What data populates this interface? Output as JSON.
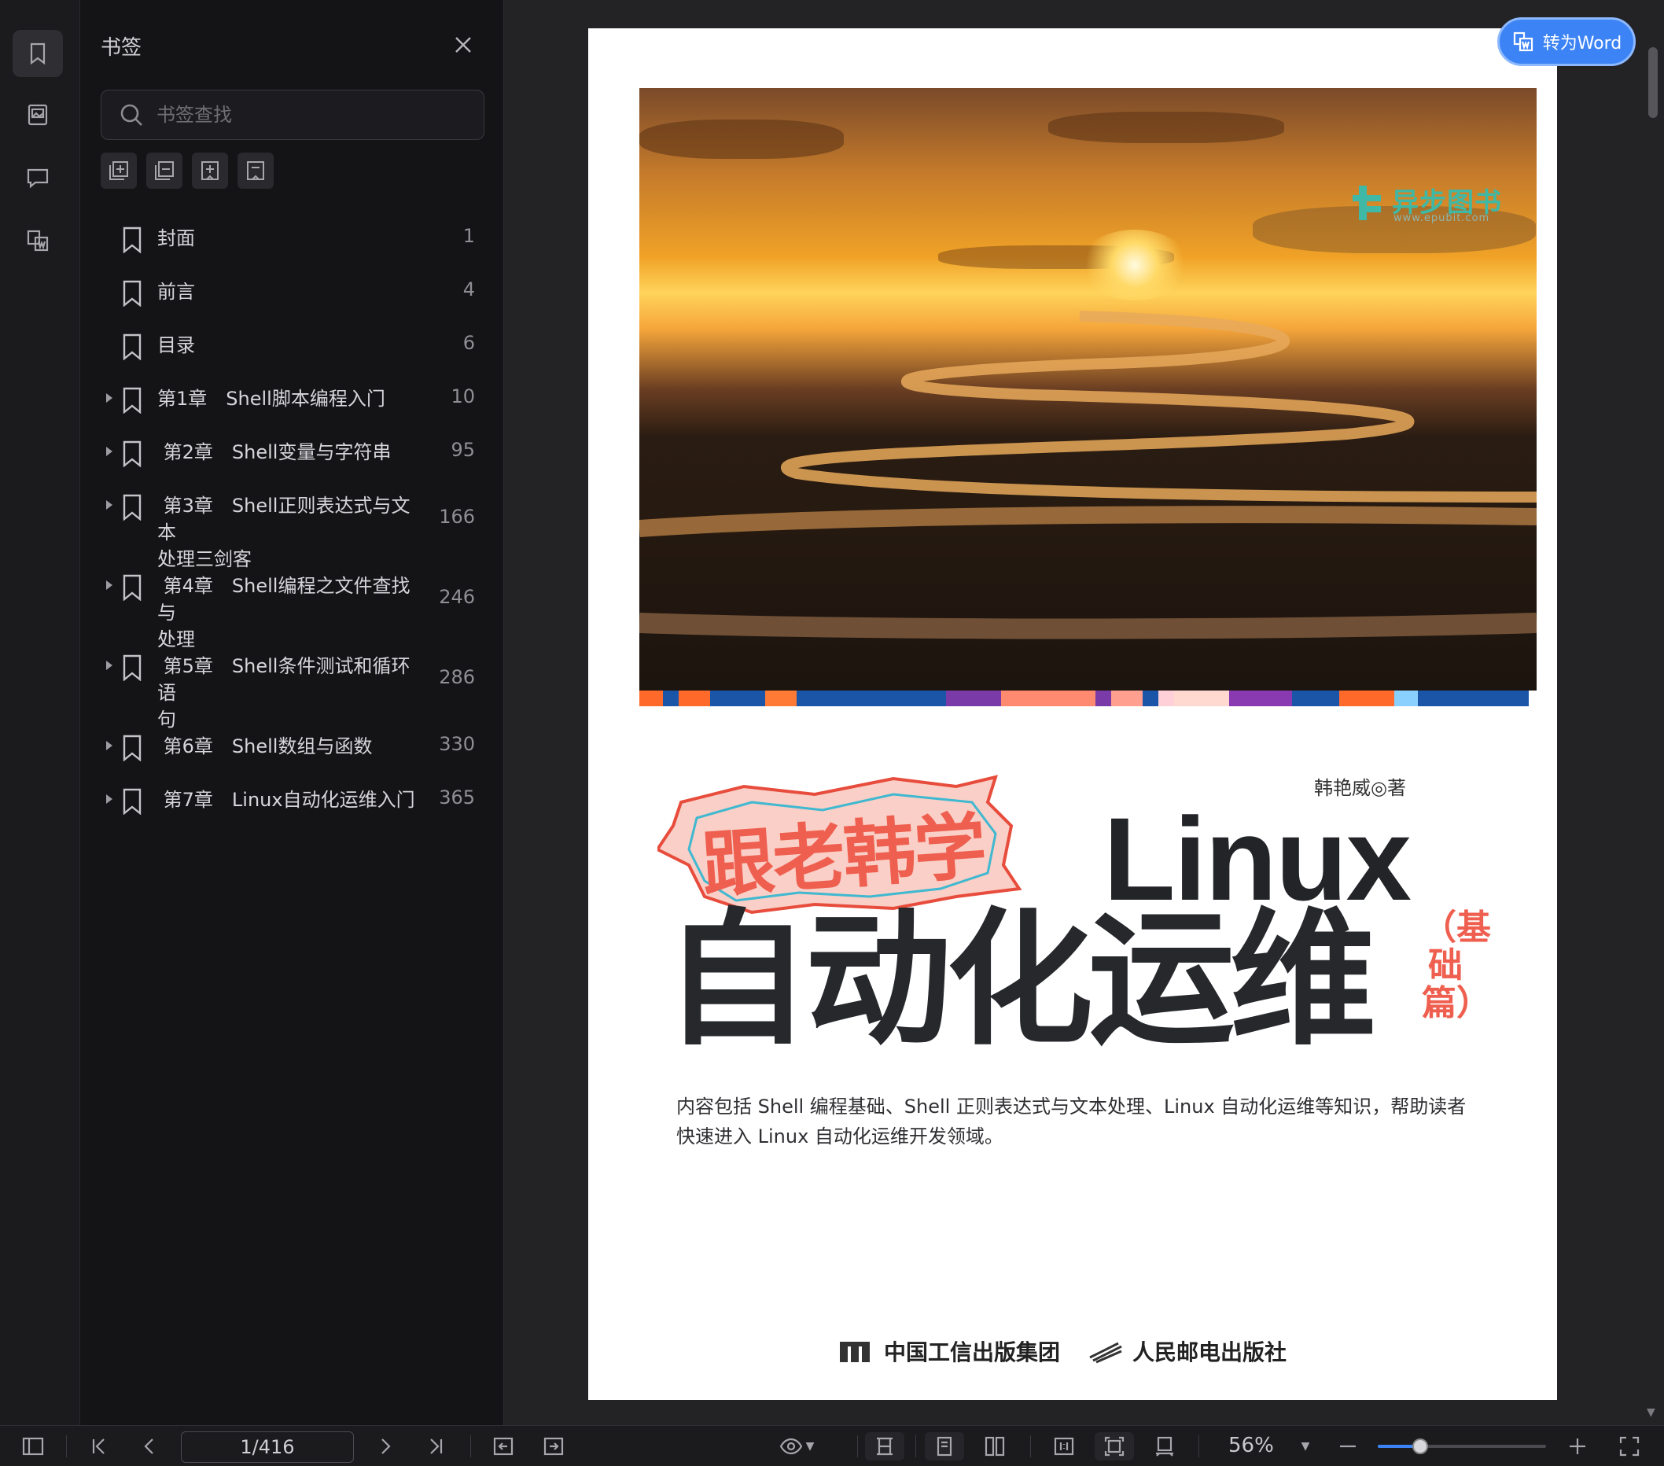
{
  "sidebar_panel": {
    "title": "书签",
    "search_placeholder": "书签查找",
    "bookmarks": [
      {
        "label": "封面",
        "page": "1",
        "expandable": false
      },
      {
        "label": "前言",
        "page": "4",
        "expandable": false
      },
      {
        "label": "目录",
        "page": "6",
        "expandable": false
      },
      {
        "label": "第1章　Shell脚本编程入门",
        "page": "10",
        "expandable": true
      },
      {
        "label": " 第2章　Shell变量与字符串",
        "page": "95",
        "expandable": true
      },
      {
        "label": " 第3章　Shell正则表达式与文本\n处理三剑客",
        "page": "166",
        "expandable": true
      },
      {
        "label": " 第4章　Shell编程之文件查找与\n处理",
        "page": "246",
        "expandable": true
      },
      {
        "label": " 第5章　Shell条件测试和循环语\n句",
        "page": "286",
        "expandable": true
      },
      {
        "label": " 第6章　Shell数组与函数",
        "page": "330",
        "expandable": true
      },
      {
        "label": " 第7章　Linux自动化运维入门",
        "page": "365",
        "expandable": true
      }
    ]
  },
  "toolbar": {
    "convert_button": "转为Word",
    "page_indicator": "1/416",
    "zoom": "56%",
    "zoom_fraction": 0.25
  },
  "cover": {
    "publisher_brand": "异步图书",
    "publisher_url": "www.epubit.com",
    "series_sticker": "跟老韩学",
    "title_en": "Linux",
    "title_zh": "自动化运维",
    "edition_tag": "（基础篇）",
    "author": "韩艳威◎著",
    "blurb": "内容包括 Shell 编程基础、Shell 正则表达式与文本处理、Linux 自动化运维等知识，帮助读者快速进入 Linux 自动化运维开发领域。",
    "press_group": "中国工信出版集团",
    "press_name": "人民邮电出版社"
  },
  "colors": {
    "accent": "#3c83f5",
    "title_red": "#ef5f4f",
    "brand_teal": "#3fb8a5",
    "panel_bg": "#141417"
  },
  "icons": [
    "bookmark-icon",
    "image-icon",
    "comment-icon",
    "convert-icon",
    "close-icon",
    "search-icon",
    "expand-all-icon",
    "collapse-all-icon",
    "add-bookmark-icon",
    "remove-bookmark-icon",
    "sidebar-toggle-icon",
    "first-page-icon",
    "prev-page-icon",
    "next-page-icon",
    "last-page-icon",
    "back-icon",
    "forward-icon",
    "eye-icon",
    "fit-page-icon",
    "single-page-icon",
    "double-page-icon",
    "actual-size-icon",
    "fit-width-icon",
    "rotate-icon",
    "zoom-out-icon",
    "zoom-in-icon",
    "fullscreen-icon"
  ]
}
